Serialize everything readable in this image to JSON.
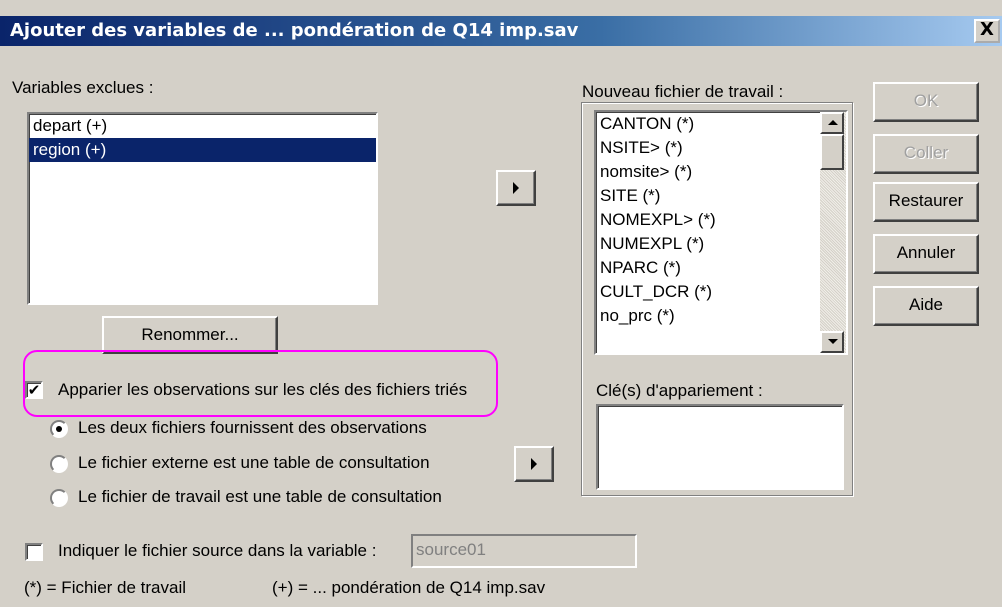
{
  "window": {
    "title": "Ajouter des variables de ... pondération de Q14 imp.sav",
    "close_label": "X"
  },
  "excluded": {
    "label": "Variables exclues :",
    "items": [
      "depart (+)",
      "region (+)"
    ],
    "selected_index": 1
  },
  "rename_button": "Renommer...",
  "match_checkbox": {
    "label": "Apparier les observations sur les clés des fichiers triés",
    "checked": true
  },
  "radio_options": [
    {
      "label": "Les deux fichiers fournissent des observations",
      "selected": true
    },
    {
      "label": "Le fichier externe est une table de consultation",
      "selected": false
    },
    {
      "label": "Le fichier de travail est une table de consultation",
      "selected": false
    }
  ],
  "source_checkbox": {
    "label": "Indiquer le fichier source dans la variable :",
    "checked": false,
    "value": "source01"
  },
  "legend": {
    "working_file": "(*) = Fichier de travail",
    "external_file": "(+) = ... pondération de Q14 imp.sav"
  },
  "new_working_file": {
    "label": "Nouveau fichier de travail :",
    "items": [
      "CANTON (*)",
      "NSITE> (*)",
      "nomsite> (*)",
      "SITE (*)",
      "NOMEXPL> (*)",
      "NUMEXPL (*)",
      "NPARC (*)",
      "CULT_DCR (*)",
      "no_prc (*)"
    ]
  },
  "match_keys": {
    "label": "Clé(s) d'appariement :",
    "items": []
  },
  "buttons": {
    "ok": "OK",
    "paste": "Coller",
    "reset": "Restaurer",
    "cancel": "Annuler",
    "help": "Aide"
  },
  "colors": {
    "face": "#d4d0c8",
    "selection": "#0a246a",
    "annotation": "#ff00ff"
  }
}
